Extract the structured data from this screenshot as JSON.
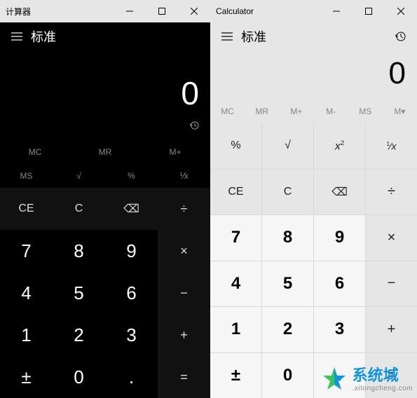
{
  "dark": {
    "title": "计算器",
    "mode": "标准",
    "display": "0",
    "memory": [
      "MC",
      "MR",
      "M+",
      "MS",
      "√",
      "%",
      "⅟x"
    ],
    "memRow1": [
      "MC",
      "MR",
      "M+"
    ],
    "memRow2": [
      "MS",
      "√",
      "%",
      "⅟x"
    ],
    "ctrl": {
      "ce": "CE",
      "c": "C",
      "back": "⌫",
      "div": "÷"
    },
    "nums": {
      "7": "7",
      "8": "8",
      "9": "9",
      "mul": "×",
      "4": "4",
      "5": "5",
      "6": "6",
      "sub": "−",
      "1": "1",
      "2": "2",
      "3": "3",
      "add": "+",
      "pm": "±",
      "0": "0",
      "dot": ".",
      "eq": "="
    }
  },
  "light": {
    "title": "Calculator",
    "mode": "标准",
    "display": "0",
    "memory": [
      "MC",
      "MR",
      "M+",
      "M-",
      "MS",
      "M▾"
    ],
    "fns": {
      "pct": "%",
      "sqrt": "√",
      "sq": "x²",
      "inv": "¹⁄x"
    },
    "ctrl": {
      "ce": "CE",
      "c": "C",
      "back": "⌫",
      "div": "÷"
    },
    "nums": {
      "7": "7",
      "8": "8",
      "9": "9",
      "mul": "×",
      "4": "4",
      "5": "5",
      "6": "6",
      "sub": "−",
      "1": "1",
      "2": "2",
      "3": "3",
      "add": "+",
      "pm": "±",
      "0": "0",
      "dot": ".",
      "eq": "="
    }
  },
  "watermark": {
    "cn": "系统城",
    "url": ".xitongcheng.com"
  }
}
